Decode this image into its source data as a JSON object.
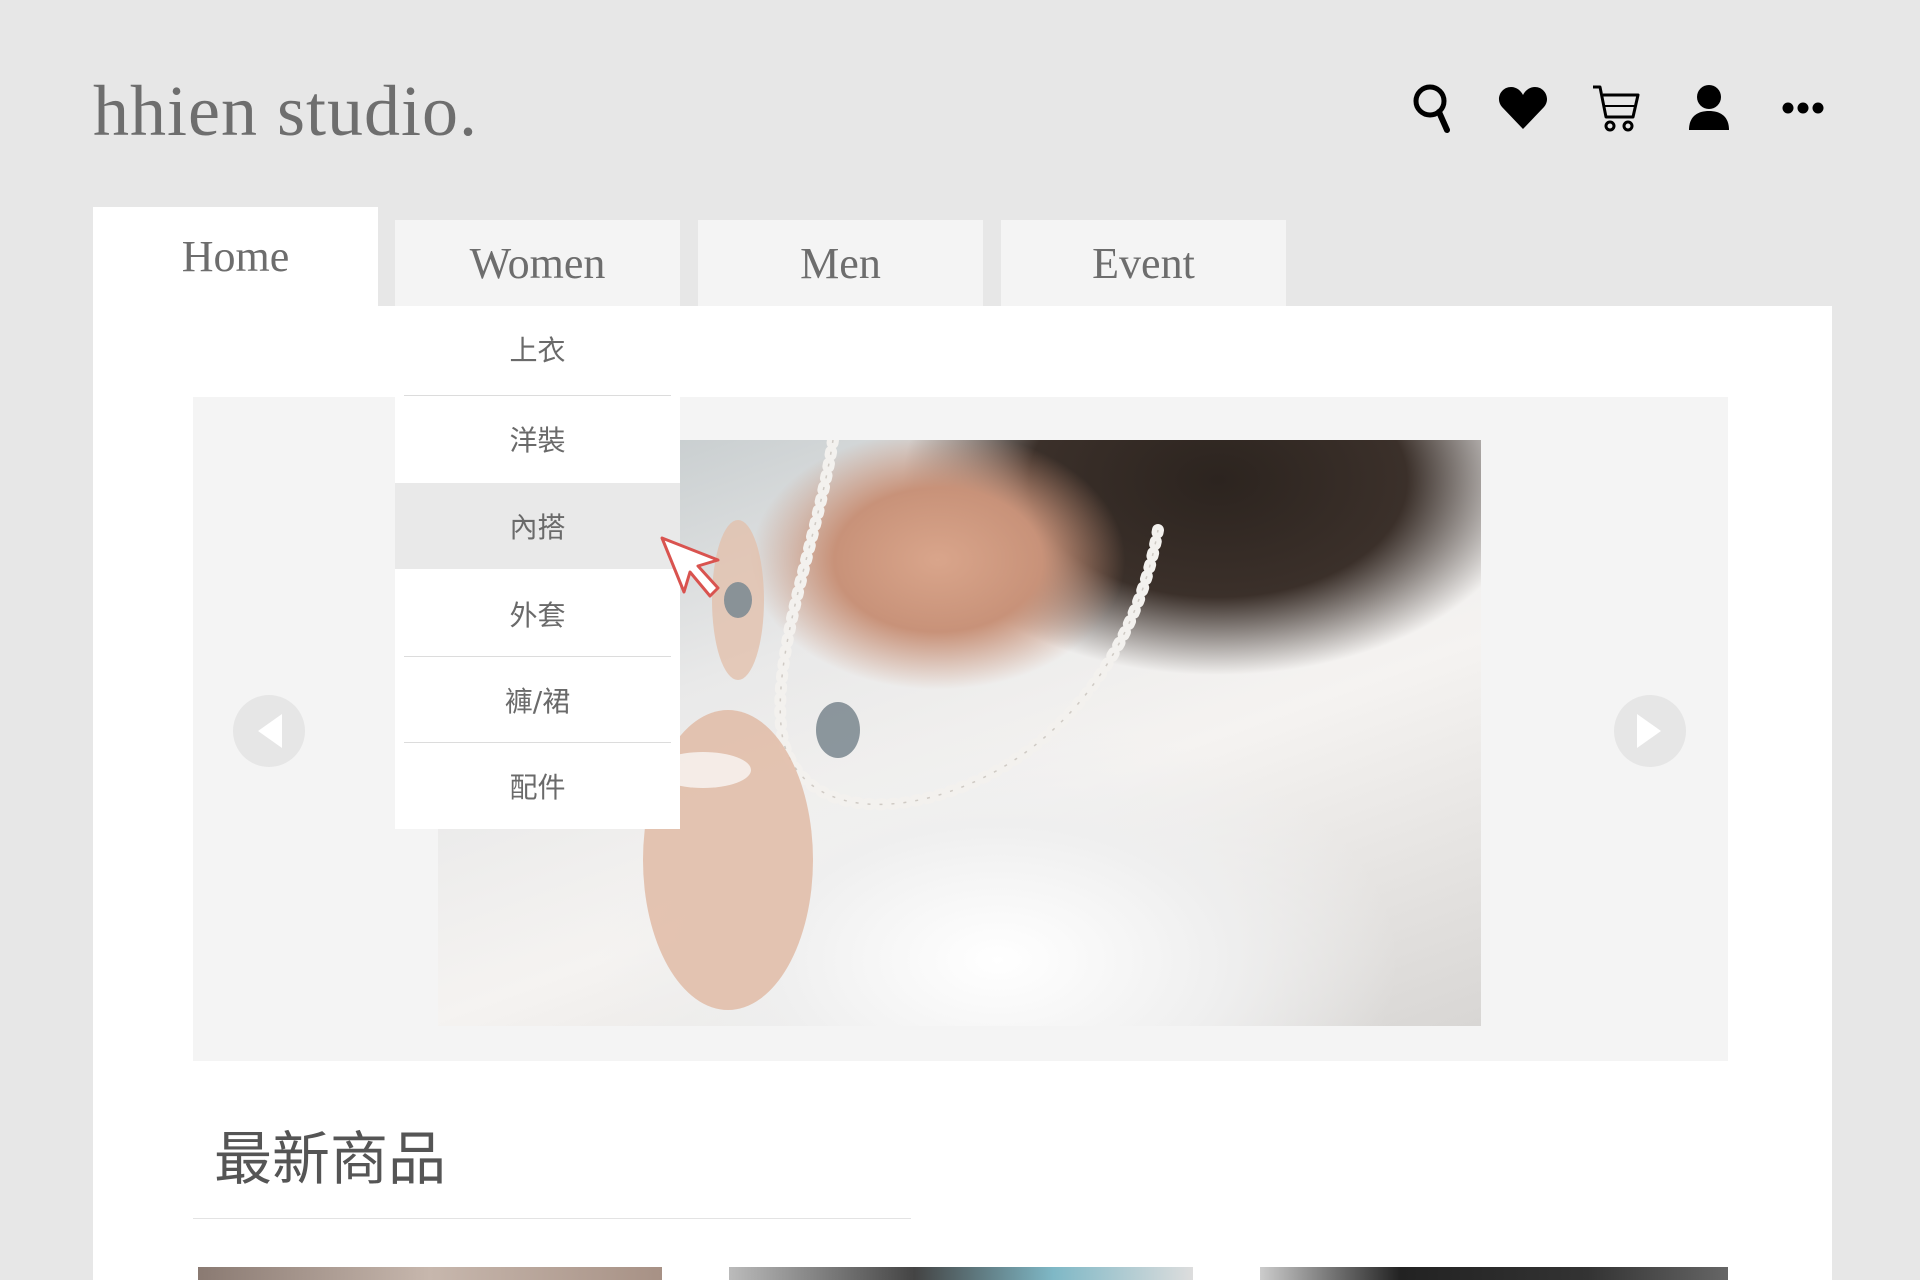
{
  "brand": {
    "logo_text": "hhien studio."
  },
  "header": {
    "icons": [
      "search-icon",
      "heart-icon",
      "cart-icon",
      "user-icon",
      "more-icon"
    ]
  },
  "nav": {
    "tabs": [
      {
        "label": "Home",
        "active": true
      },
      {
        "label": "Women",
        "active": false
      },
      {
        "label": "Men",
        "active": false
      },
      {
        "label": "Event",
        "active": false
      }
    ]
  },
  "dropdown": {
    "parent": "Women",
    "items": [
      {
        "label": "上衣"
      },
      {
        "label": "洋裝"
      },
      {
        "label": "內搭",
        "hovered": true
      },
      {
        "label": "外套"
      },
      {
        "label": "褲/裙"
      },
      {
        "label": "配件"
      }
    ]
  },
  "main": {
    "section_title": "最新商品"
  },
  "colors": {
    "page_bg": "#e7e7e7",
    "panel_bg": "#ffffff",
    "banner_bg": "#f4f4f4",
    "tab_bg": "#f4f4f4",
    "text_gray": "#6d6d6d",
    "hover_bg": "#e9e9e9",
    "cursor_red": "#d9534f"
  }
}
